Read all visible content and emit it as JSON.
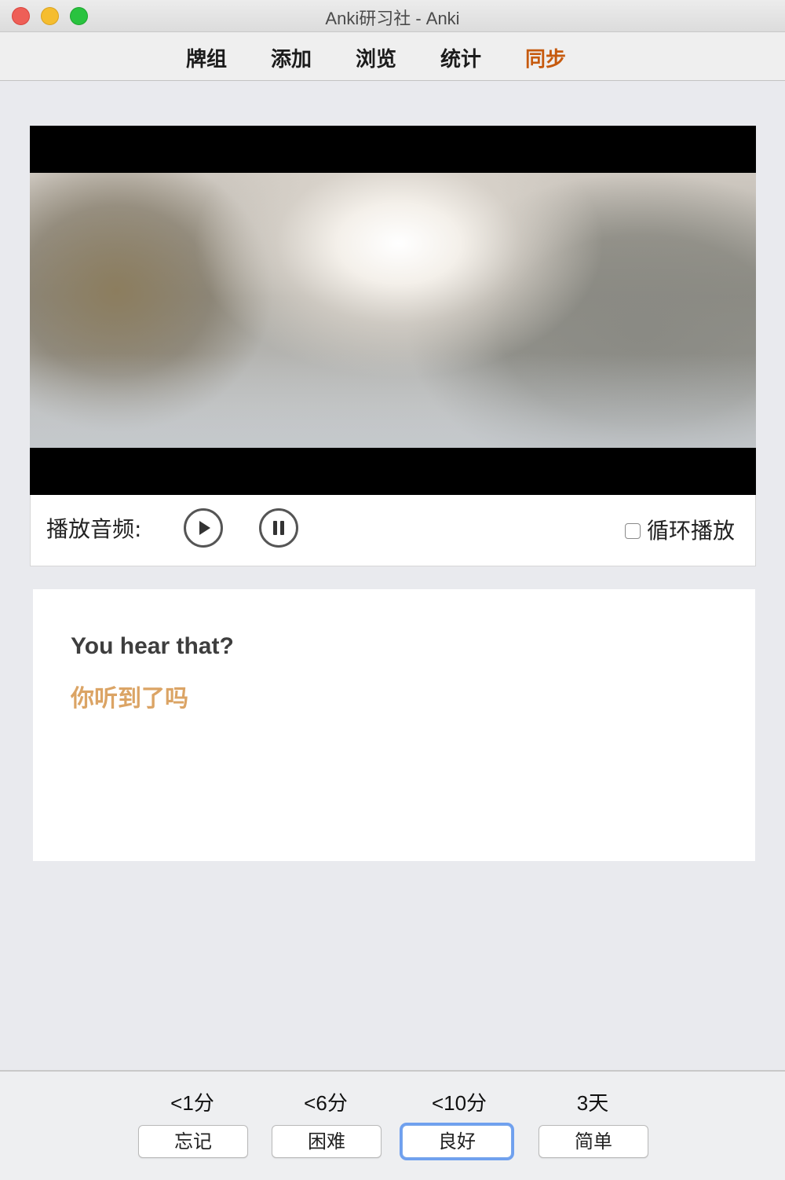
{
  "window": {
    "title": "Anki研习社 - Anki"
  },
  "toolbar": {
    "items": [
      {
        "label": "牌组"
      },
      {
        "label": "添加"
      },
      {
        "label": "浏览"
      },
      {
        "label": "统计"
      },
      {
        "label": "同步",
        "active": true
      }
    ],
    "active_color": "#c65a0e"
  },
  "media": {
    "audio_label": "播放音频:",
    "play_icon": "play-circle-icon",
    "pause_icon": "pause-circle-icon",
    "loop_label": "循环播放",
    "loop_checked": false
  },
  "card": {
    "english": "You hear that?",
    "chinese": "你听到了吗",
    "chinese_color": "#dba465"
  },
  "answer_bar": {
    "buttons": [
      {
        "interval": "<1分",
        "label": "忘记"
      },
      {
        "interval": "<6分",
        "label": "困难"
      },
      {
        "interval": "<10分",
        "label": "良好",
        "focused": true
      },
      {
        "interval": "3天",
        "label": "简单"
      }
    ]
  }
}
